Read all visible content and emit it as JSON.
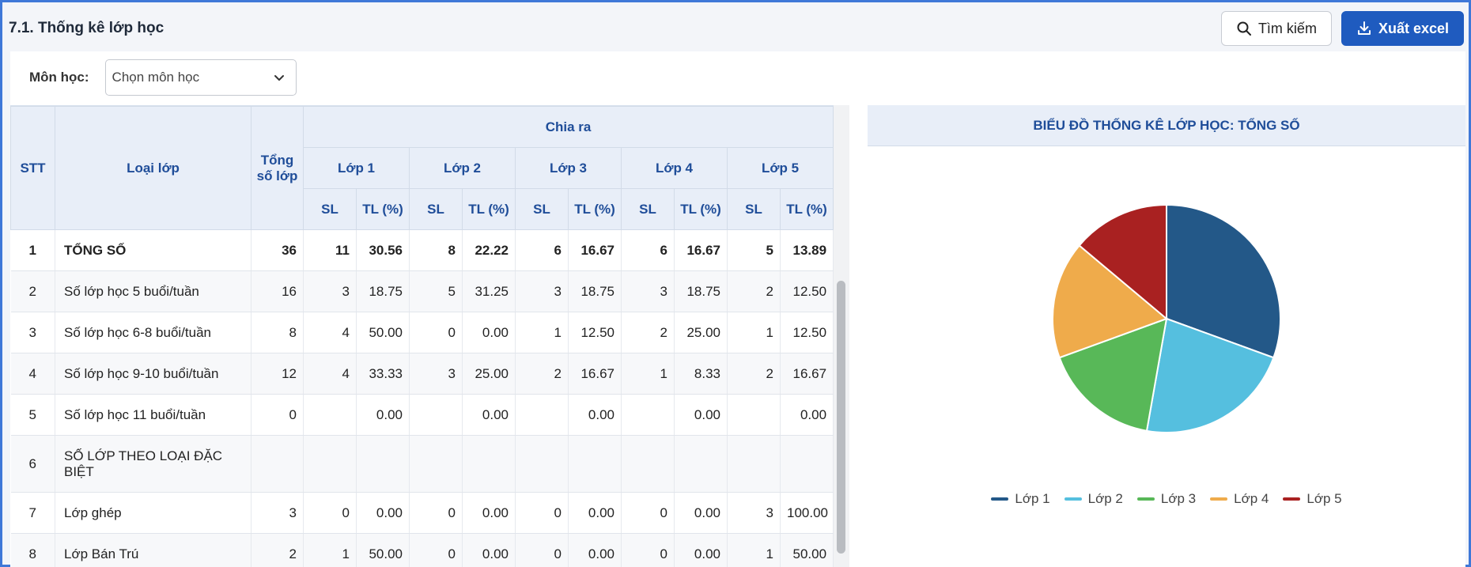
{
  "header": {
    "title": "7.1. Thống kê lớp học",
    "search_label": "Tìm kiếm",
    "export_label": "Xuất excel"
  },
  "filter": {
    "label": "Môn học:",
    "placeholder": "Chọn môn học"
  },
  "table": {
    "headers": {
      "stt": "STT",
      "type": "Loại lớp",
      "total": "Tổng số lớp",
      "group": "Chia ra",
      "grades": [
        "Lớp 1",
        "Lớp 2",
        "Lớp 3",
        "Lớp 4",
        "Lớp 5"
      ],
      "sl": "SL",
      "tl": "TL (%)"
    },
    "rows": [
      {
        "stt": "1",
        "name": "TỔNG SỐ",
        "total": "36",
        "cells": [
          "11",
          "30.56",
          "8",
          "22.22",
          "6",
          "16.67",
          "6",
          "16.67",
          "5",
          "13.89"
        ]
      },
      {
        "stt": "2",
        "name": "Số lớp học 5 buổi/tuần",
        "total": "16",
        "cells": [
          "3",
          "18.75",
          "5",
          "31.25",
          "3",
          "18.75",
          "3",
          "18.75",
          "2",
          "12.50"
        ]
      },
      {
        "stt": "3",
        "name": "Số lớp học 6-8 buổi/tuần",
        "total": "8",
        "cells": [
          "4",
          "50.00",
          "0",
          "0.00",
          "1",
          "12.50",
          "2",
          "25.00",
          "1",
          "12.50"
        ]
      },
      {
        "stt": "4",
        "name": "Số lớp học 9-10 buổi/tuần",
        "total": "12",
        "cells": [
          "4",
          "33.33",
          "3",
          "25.00",
          "2",
          "16.67",
          "1",
          "8.33",
          "2",
          "16.67"
        ]
      },
      {
        "stt": "5",
        "name": "Số lớp học 11 buổi/tuần",
        "total": "0",
        "cells": [
          "",
          "0.00",
          "",
          "0.00",
          "",
          "0.00",
          "",
          "0.00",
          "",
          "0.00"
        ]
      },
      {
        "stt": "6",
        "name": "SỐ LỚP THEO LOẠI ĐẶC BIỆT",
        "total": "",
        "cells": [
          "",
          "",
          "",
          "",
          "",
          "",
          "",
          "",
          "",
          ""
        ]
      },
      {
        "stt": "7",
        "name": "Lớp ghép",
        "total": "3",
        "cells": [
          "0",
          "0.00",
          "0",
          "0.00",
          "0",
          "0.00",
          "0",
          "0.00",
          "3",
          "100.00"
        ]
      },
      {
        "stt": "8",
        "name": "Lớp Bán Trú",
        "total": "2",
        "cells": [
          "1",
          "50.00",
          "0",
          "0.00",
          "0",
          "0.00",
          "0",
          "0.00",
          "1",
          "50.00"
        ]
      }
    ]
  },
  "chart": {
    "title": "BIỂU ĐỒ THỐNG KÊ LỚP HỌC: TỔNG SỐ",
    "colors": [
      "#235888",
      "#55bfdf",
      "#58b858",
      "#efab4b",
      "#a92121"
    ]
  },
  "chart_data": {
    "type": "pie",
    "title": "BIỂU ĐỒ THỐNG KÊ LỚP HỌC: TỔNG SỐ",
    "categories": [
      "Lớp 1",
      "Lớp 2",
      "Lớp 3",
      "Lớp 4",
      "Lớp 5"
    ],
    "values": [
      11,
      8,
      6,
      6,
      5
    ],
    "legend": "bottom"
  }
}
